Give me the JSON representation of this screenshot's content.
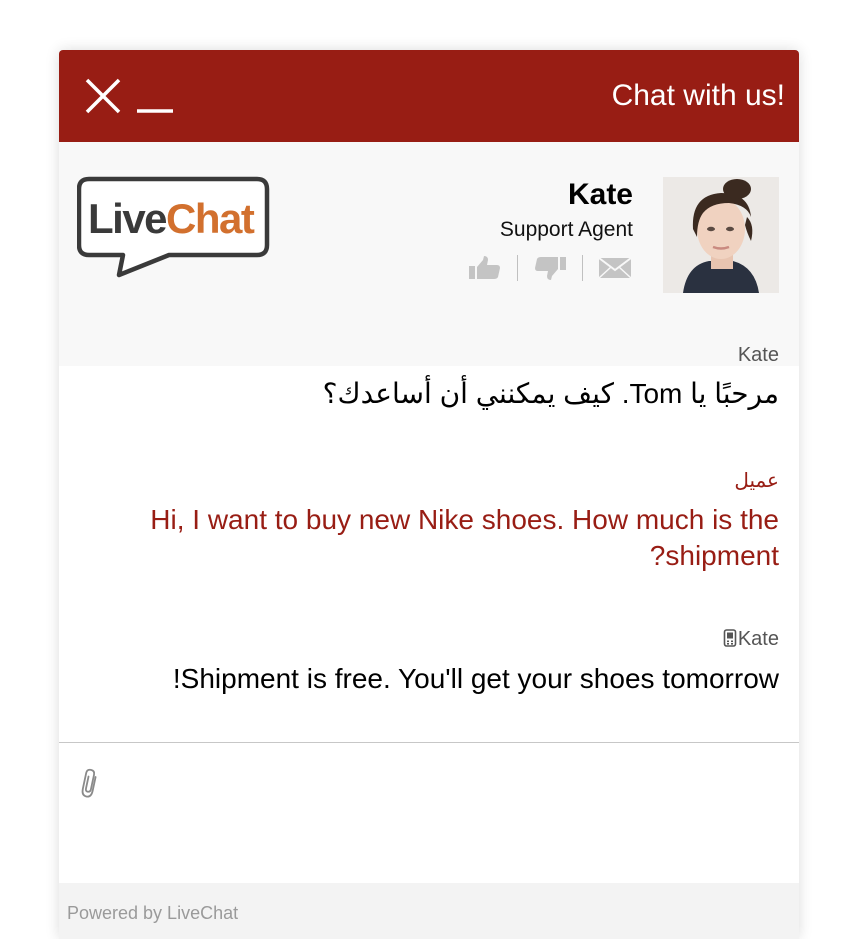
{
  "colors": {
    "header_bg": "#981d14",
    "customer_text": "#981d14",
    "logo_orange": "#d2702e",
    "logo_dark": "#3a3a3a"
  },
  "header": {
    "title": "Chat with us!",
    "close_icon": "close-icon",
    "minimize_icon": "minimize-icon"
  },
  "agent": {
    "name": "Kate",
    "role": "Support Agent",
    "actions": [
      "thumbs-up-icon",
      "thumbs-down-icon",
      "envelope-icon"
    ]
  },
  "logo": {
    "part1": "Live",
    "part2": "Chat"
  },
  "messages": [
    {
      "author": "Kate",
      "text": "مرحبًا يا Tom. كيف يمكنني أن أساعدك؟"
    },
    {
      "author": "عميل",
      "text": "Hi, I want to buy new Nike shoes. How much is the shipment?"
    },
    {
      "author": "Kate",
      "author_icon": "mobile-phone-icon",
      "text": "Shipment is free. You'll get your shoes tomorrow!"
    }
  ],
  "composer": {
    "attach_icon": "paperclip-icon",
    "placeholder": ""
  },
  "footer": {
    "powered_by": "Powered by LiveChat"
  }
}
